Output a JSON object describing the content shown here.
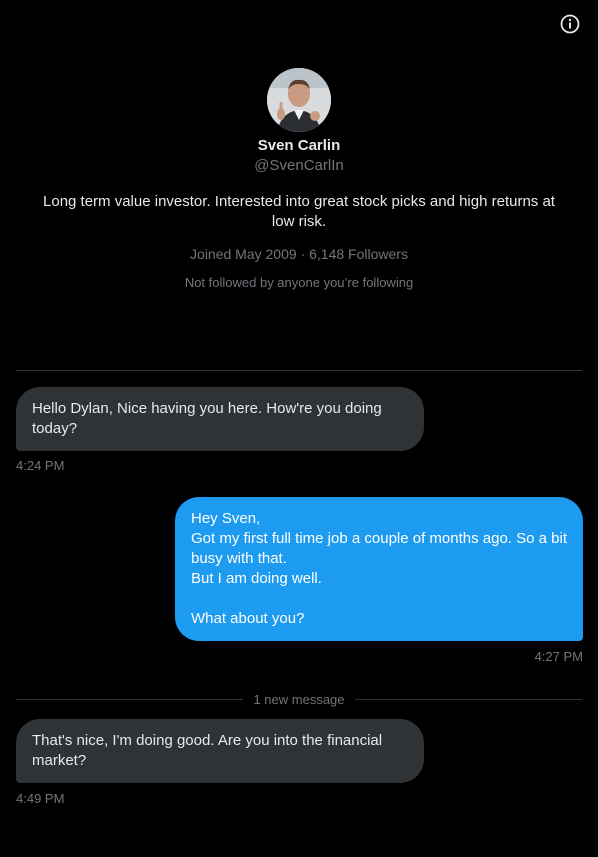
{
  "profile": {
    "name": "Sven Carlin",
    "handle": "@SvenCarlIn",
    "bio": "Long term value investor. Interested into great stock picks and high returns at low risk.",
    "joined": "Joined May 2009",
    "separator": "·",
    "followers": "6,148 Followers",
    "followed_note": "Not followed by anyone you’re following"
  },
  "messages": [
    {
      "direction": "received",
      "text": "Hello Dylan, Nice having you here. How're you doing today?",
      "time": "4:24 PM"
    },
    {
      "direction": "sent",
      "text": "Hey Sven,\nGot my first full time job a couple of months ago. So a bit busy with that.\nBut I am doing well.\n\nWhat about you?",
      "time": "4:27 PM"
    },
    {
      "direction": "received",
      "text": "That's nice, I'm doing good. Are you into the financial market?",
      "time": "4:49 PM"
    }
  ],
  "new_message_divider": "1 new message",
  "colors": {
    "background": "#000000",
    "received_bubble": "#2f3336",
    "sent_bubble": "#1d9bf0",
    "secondary_text": "#71767b",
    "primary_text": "#e7e9ea"
  },
  "icons": {
    "info": "info-circle-icon"
  }
}
